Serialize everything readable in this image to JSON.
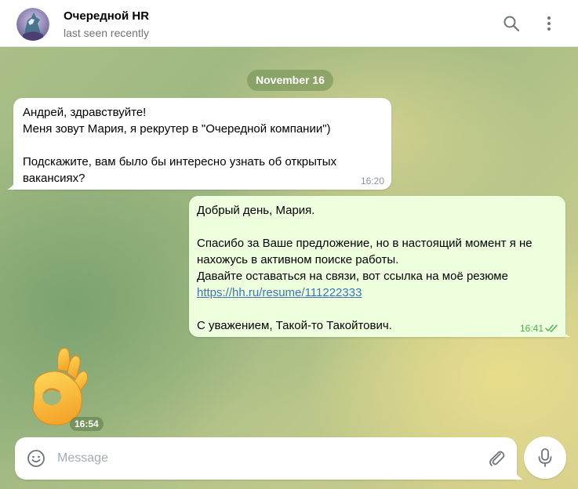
{
  "header": {
    "chat_name": "Очередной HR",
    "status": "last seen recently",
    "search_icon": "search-icon",
    "menu_icon": "more-vertical-icon"
  },
  "chat": {
    "date_label": "November 16",
    "incoming_message": {
      "lines": [
        "Андрей, здравствуйте!",
        "Меня зовут Мария, я рекрутер в \"Очередной компании\")",
        "",
        "Подскажите, вам было бы интересно узнать об открытых",
        "вакансиях?"
      ],
      "time": "16:20"
    },
    "outgoing_message": {
      "lines": [
        "Добрый день, Мария.",
        "",
        "Спасибо за Ваше предложение, но в настоящий момент я не",
        "нахожусь в активном поиске работы.",
        "Давайте оставаться на связи, вот ссылка на моё резюме"
      ],
      "link": "https://hh.ru/resume/111222333",
      "signature": "С уважением, Такой-то Такойтович.",
      "time": "16:41",
      "status_icon": "double-check-icon"
    },
    "sticker": {
      "emoji": "ok-hand-sticker",
      "time": "16:54"
    }
  },
  "composer": {
    "placeholder": "Message",
    "emoji_icon": "smile-icon",
    "attach_icon": "paperclip-icon",
    "mic_icon": "microphone-icon"
  },
  "colors": {
    "outgoing_bubble": "#eeffde",
    "incoming_bubble": "#ffffff",
    "link": "#3a76b5",
    "read_check": "#4fae4e",
    "secondary_text": "#707579"
  }
}
